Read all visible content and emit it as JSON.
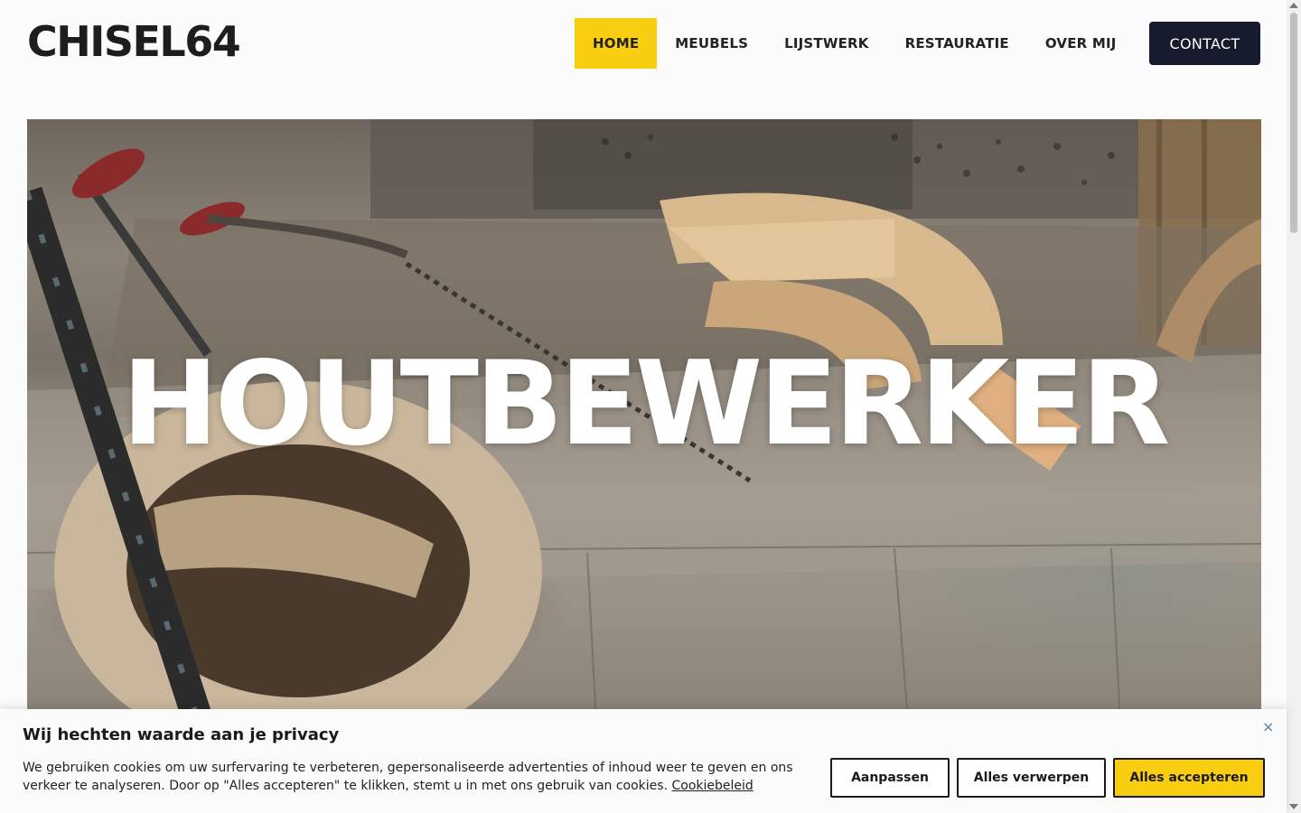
{
  "header": {
    "logo": "CHISEL64",
    "nav": [
      {
        "label": "HOME",
        "active": true
      },
      {
        "label": "MEUBELS",
        "active": false
      },
      {
        "label": "LIJSTWERK",
        "active": false
      },
      {
        "label": "RESTAURATIE",
        "active": false
      },
      {
        "label": "OVER MIJ",
        "active": false
      }
    ],
    "contact_label": "CONTACT"
  },
  "hero": {
    "title": "HOUTBEWERKER"
  },
  "cookie_banner": {
    "title": "Wij hechten waarde aan je privacy",
    "text": "We gebruiken cookies om uw surfervaring te verbeteren, gepersonaliseerde advertenties of inhoud weer te geven en ons verkeer te analyseren. Door op \"Alles accepteren\" te klikken, stemt u in met ons gebruik van cookies.",
    "policy_link": "Cookiebeleid",
    "close": "×",
    "buttons": {
      "customize": "Aanpassen",
      "reject": "Alles verwerpen",
      "accept": "Alles accepteren"
    }
  },
  "colors": {
    "accent": "#f9cd10",
    "dark": "#151b2c",
    "background": "#fbfbfb"
  }
}
